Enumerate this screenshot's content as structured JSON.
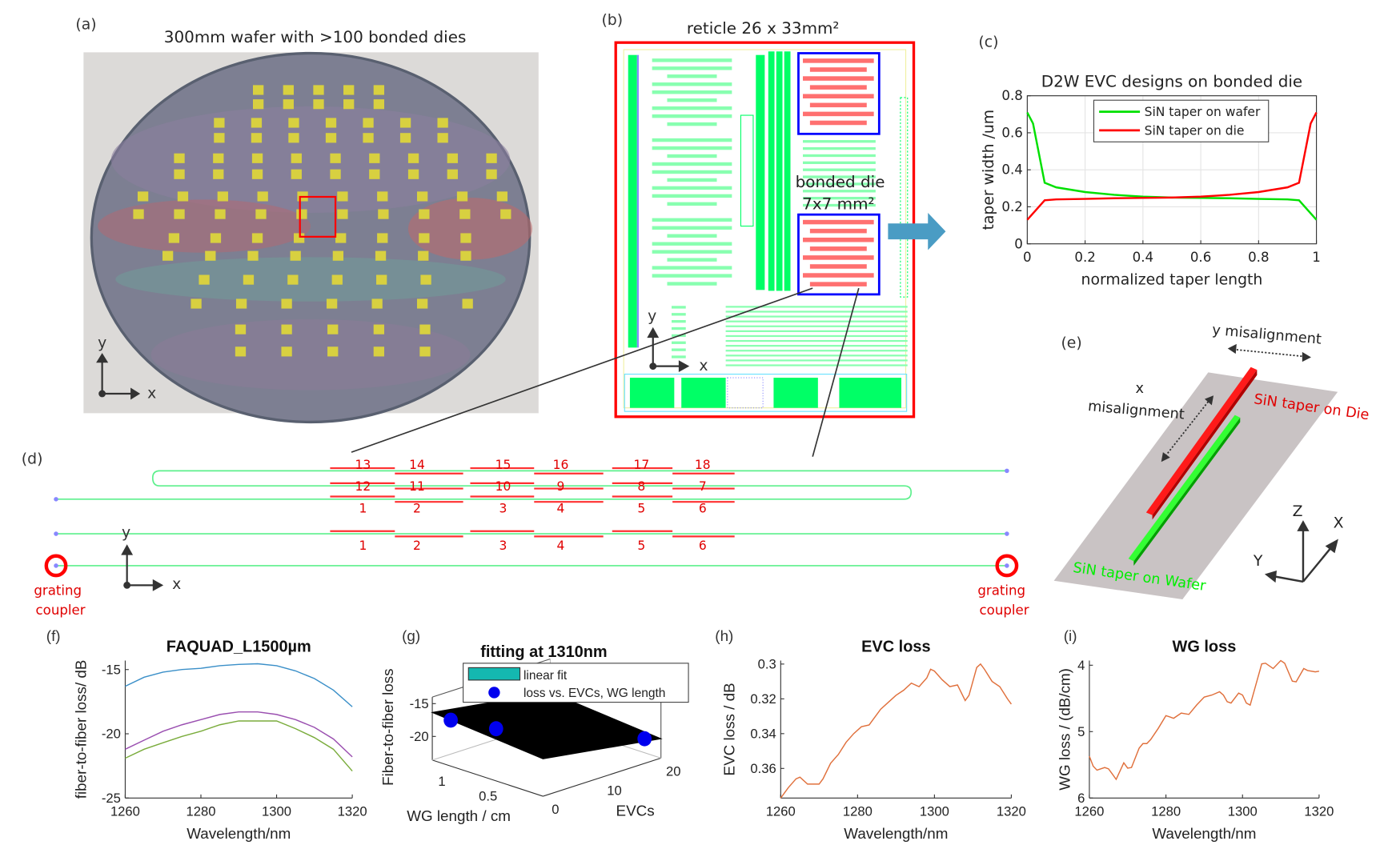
{
  "panels": {
    "a": {
      "label": "(a)",
      "title": "300mm wafer with >100 bonded dies",
      "axis_y": "y",
      "axis_x": "x"
    },
    "b": {
      "label": "(b)",
      "title": "reticle 26 x 33mm²",
      "die_label_1": "bonded die",
      "die_label_2": "7x7 mm²",
      "axis_y": "y",
      "axis_x": "x"
    },
    "c": {
      "label": "(c)"
    },
    "d": {
      "label": "(d)",
      "axis_y": "y",
      "axis_x": "x",
      "row_top": [
        "13",
        "14",
        "15",
        "16",
        "17",
        "18"
      ],
      "row_mid": [
        "12",
        "11",
        "10",
        "9",
        "8",
        "7"
      ],
      "row_low": [
        "1",
        "2",
        "3",
        "4",
        "5",
        "6"
      ],
      "row_single": [
        "1",
        "2",
        "3",
        "4",
        "5",
        "6"
      ],
      "coupler_left": [
        "grating",
        "coupler"
      ],
      "coupler_right": [
        "grating",
        "coupler"
      ]
    },
    "e": {
      "label": "(e)",
      "y_mis": "y misalignment",
      "x_mis_1": "x",
      "x_mis_2": "misalignment",
      "die_taper": "SiN taper on Die",
      "wafer_taper": "SiN taper on Wafer",
      "axis_z": "Z",
      "axis_x": "X",
      "axis_y": "Y"
    },
    "f": {
      "label": "(f)"
    },
    "g": {
      "label": "(g)"
    },
    "h": {
      "label": "(h)"
    },
    "i": {
      "label": "(i)"
    }
  },
  "colors": {
    "wafer_taper": "#00e000",
    "die_taper": "#ff0000",
    "layout_green": "#00ff66",
    "die_box": "#0000ff",
    "reticle_box": "#ff0000",
    "arrow": "#4a9cc4"
  },
  "chart_data": [
    {
      "id": "c",
      "type": "line",
      "title": "D2W EVC designs on bonded die",
      "xlabel": "normalized taper length",
      "ylabel": "taper width /um",
      "xlim": [
        0,
        1
      ],
      "ylim": [
        0,
        0.8
      ],
      "xticks": [
        0,
        0.2,
        0.4,
        0.6,
        0.8,
        1
      ],
      "xtick_labels": [
        "0",
        "0.2",
        "0.4",
        "0.6",
        "0.8",
        "1"
      ],
      "yticks": [
        0,
        0.2,
        0.4,
        0.6,
        0.8
      ],
      "ytick_labels": [
        "0",
        "0.2",
        "0.4",
        "0.6",
        "0.8"
      ],
      "grid": true,
      "legend": "top-center",
      "series": [
        {
          "name": "SiN taper on wafer",
          "color": "#00e000",
          "x": [
            0,
            0.02,
            0.06,
            0.1,
            0.2,
            0.3,
            0.4,
            0.5,
            0.6,
            0.7,
            0.8,
            0.9,
            0.94,
            1
          ],
          "y": [
            0.71,
            0.65,
            0.33,
            0.305,
            0.28,
            0.265,
            0.255,
            0.25,
            0.248,
            0.246,
            0.243,
            0.24,
            0.235,
            0.13
          ]
        },
        {
          "name": "SiN taper on die",
          "color": "#ff0000",
          "x": [
            0,
            0.06,
            0.1,
            0.2,
            0.3,
            0.4,
            0.5,
            0.6,
            0.7,
            0.8,
            0.9,
            0.94,
            0.98,
            1
          ],
          "y": [
            0.13,
            0.235,
            0.24,
            0.243,
            0.246,
            0.248,
            0.25,
            0.255,
            0.265,
            0.28,
            0.305,
            0.33,
            0.65,
            0.71
          ]
        }
      ]
    },
    {
      "id": "f",
      "type": "line",
      "title": "FAQUAD_L1500µm",
      "xlabel": "Wavelength/nm",
      "ylabel": "fiber-to-fiber loss/ dB",
      "xlim": [
        1260,
        1320
      ],
      "ylim": [
        -25,
        -14.3
      ],
      "xticks": [
        1260,
        1280,
        1300,
        1320
      ],
      "xtick_labels": [
        "1260",
        "1280",
        "1300",
        "1320"
      ],
      "yticks": [
        -25,
        -20,
        -15
      ],
      "ytick_labels": [
        "-25",
        "-20",
        "-15"
      ],
      "grid": false,
      "series": [
        {
          "color": "#3a8fc8",
          "x": [
            1260,
            1265,
            1270,
            1275,
            1280,
            1285,
            1290,
            1295,
            1300,
            1305,
            1310,
            1315,
            1320
          ],
          "y": [
            -16.3,
            -15.6,
            -15.2,
            -15.0,
            -14.9,
            -14.7,
            -14.6,
            -14.55,
            -14.7,
            -15.1,
            -15.7,
            -16.6,
            -17.9
          ]
        },
        {
          "color": "#9a4fb0",
          "x": [
            1260,
            1265,
            1270,
            1275,
            1280,
            1285,
            1290,
            1295,
            1300,
            1305,
            1310,
            1315,
            1320
          ],
          "y": [
            -21.2,
            -20.5,
            -19.8,
            -19.3,
            -18.9,
            -18.5,
            -18.3,
            -18.3,
            -18.5,
            -18.9,
            -19.5,
            -20.4,
            -21.8
          ]
        },
        {
          "color": "#7aac3c",
          "x": [
            1260,
            1265,
            1270,
            1275,
            1280,
            1285,
            1290,
            1295,
            1300,
            1305,
            1310,
            1315,
            1320
          ],
          "y": [
            -21.9,
            -21.2,
            -20.7,
            -20.2,
            -19.8,
            -19.3,
            -19.0,
            -19.0,
            -19.0,
            -19.6,
            -20.3,
            -21.2,
            -22.9
          ]
        }
      ]
    },
    {
      "id": "g",
      "type": "scatter3d",
      "title": "fitting at 1310nm",
      "xlabel": "WG length / cm",
      "ylabel": "EVCs",
      "zlabel": "Fiber-to-fiber loss",
      "xlim": [
        0,
        1.2
      ],
      "ylim": [
        0,
        20
      ],
      "zlim": [
        -23.6,
        -14
      ],
      "xtick_labels": [
        "0.5",
        "1"
      ],
      "ytick_labels": [
        "0",
        "10",
        "20"
      ],
      "ztick_labels": [
        "-15",
        "-20"
      ],
      "xticks": [
        0.5,
        1
      ],
      "yticks": [
        0,
        10,
        20
      ],
      "zticks": [
        -15,
        -20
      ],
      "legend": [
        "linear fit",
        "loss vs. EVCs, WG length"
      ],
      "fit_color": "#14b8b0",
      "point_color": "#0000ee",
      "points": [
        {
          "wg_length": 1.0,
          "evcs": 0,
          "loss": -16.6
        },
        {
          "wg_length": 0.7,
          "evcs": 3,
          "loss": -17.4
        },
        {
          "wg_length": 0.05,
          "evcs": 18,
          "loss": -20.3
        }
      ]
    },
    {
      "id": "h",
      "type": "line",
      "title": "EVC loss",
      "xlabel": "Wavelength/nm",
      "ylabel": "EVC loss / dB",
      "xlim": [
        1260,
        1320
      ],
      "ylim": [
        0.377,
        0.298
      ],
      "y_reversed": true,
      "xticks": [
        1260,
        1280,
        1300,
        1320
      ],
      "xtick_labels": [
        "1260",
        "1280",
        "1300",
        "1320"
      ],
      "yticks": [
        0.3,
        0.32,
        0.34,
        0.36
      ],
      "ytick_labels": [
        "0.3",
        "0.32",
        "0.34",
        "0.36"
      ],
      "grid": false,
      "series": [
        {
          "color": "#e0703c",
          "x": [
            1260,
            1262,
            1264,
            1265,
            1267,
            1270,
            1271,
            1273,
            1275,
            1277,
            1279,
            1281,
            1283,
            1284,
            1286,
            1288,
            1290,
            1292,
            1294,
            1296,
            1298,
            1299,
            1300,
            1302,
            1304,
            1306,
            1308,
            1309,
            1311,
            1312,
            1313,
            1315,
            1317,
            1319,
            1320
          ],
          "y": [
            0.377,
            0.371,
            0.366,
            0.365,
            0.369,
            0.369,
            0.366,
            0.357,
            0.352,
            0.345,
            0.34,
            0.336,
            0.335,
            0.332,
            0.326,
            0.322,
            0.318,
            0.315,
            0.311,
            0.313,
            0.308,
            0.303,
            0.304,
            0.309,
            0.313,
            0.312,
            0.321,
            0.318,
            0.302,
            0.3,
            0.303,
            0.31,
            0.313,
            0.32,
            0.323
          ]
        }
      ]
    },
    {
      "id": "i",
      "type": "line",
      "title": "WG loss",
      "xlabel": "Wavelength/nm",
      "ylabel": "WG loss / (dB/cm)",
      "xlim": [
        1260,
        1320
      ],
      "ylim": [
        6,
        3.93
      ],
      "y_reversed": true,
      "xticks": [
        1260,
        1280,
        1300,
        1320
      ],
      "xtick_labels": [
        "1260",
        "1280",
        "1300",
        "1320"
      ],
      "yticks": [
        4,
        5,
        6
      ],
      "ytick_labels": [
        "4",
        "5",
        "6"
      ],
      "grid": false,
      "series": [
        {
          "color": "#e0703c",
          "x": [
            1260,
            1261,
            1262,
            1264,
            1265,
            1266,
            1267,
            1269,
            1270,
            1271,
            1273,
            1274,
            1275,
            1276,
            1278,
            1280,
            1281,
            1282,
            1284,
            1286,
            1288,
            1290,
            1292,
            1294,
            1295,
            1296,
            1297,
            1299,
            1300,
            1301,
            1302,
            1305,
            1306,
            1308,
            1310,
            1311,
            1313,
            1314,
            1316,
            1317,
            1319,
            1320
          ],
          "y": [
            5.37,
            5.52,
            5.58,
            5.54,
            5.56,
            5.64,
            5.72,
            5.47,
            5.55,
            5.54,
            5.25,
            5.18,
            5.18,
            5.12,
            4.95,
            4.76,
            4.78,
            4.8,
            4.72,
            4.74,
            4.6,
            4.48,
            4.45,
            4.4,
            4.45,
            4.55,
            4.57,
            4.42,
            4.45,
            4.57,
            4.6,
            3.98,
            3.97,
            4.05,
            3.93,
            3.97,
            4.24,
            4.25,
            4.05,
            4.08,
            4.1,
            4.09
          ]
        }
      ]
    }
  ]
}
